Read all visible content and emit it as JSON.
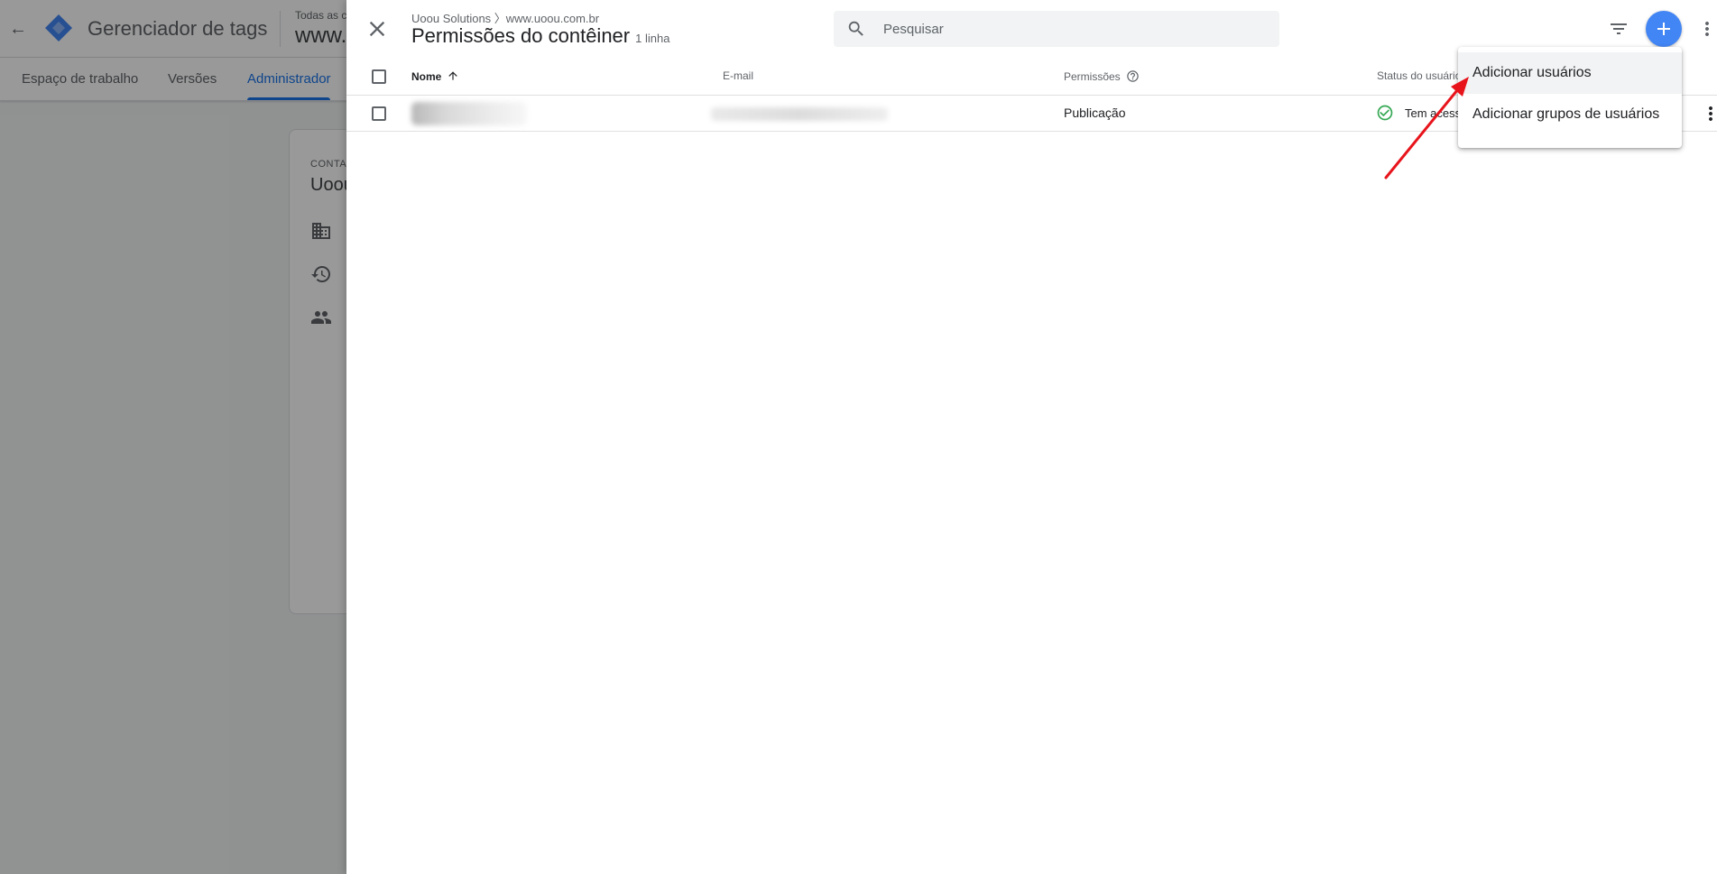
{
  "app": {
    "title": "Gerenciador de tags",
    "account_label": "Todas as c",
    "container_name": "www.",
    "tabs": [
      {
        "label": "Espaço de trabalho"
      },
      {
        "label": "Versões"
      },
      {
        "label": "Administrador",
        "active": true
      }
    ],
    "card": {
      "label": "CONTA",
      "title": "Uoou"
    }
  },
  "panel": {
    "breadcrumb": "Uoou Solutions 〉www.uoou.com.br",
    "title": "Permissões do contêiner",
    "row_count": "1 linha",
    "search": {
      "placeholder": "Pesquisar",
      "value": ""
    },
    "columns": {
      "name": "Nome",
      "email": "E-mail",
      "permissions": "Permissões",
      "status": "Status do usuário"
    },
    "rows": [
      {
        "name": "",
        "email": "",
        "permission": "Publicação",
        "status": "Tem acesso"
      }
    ],
    "menu": {
      "items": [
        {
          "label": "Adicionar usuários"
        },
        {
          "label": "Adicionar grupos de usuários"
        }
      ]
    }
  },
  "colors": {
    "accent": "#1a73e8",
    "fab": "#4285f4",
    "status_ok": "#34a853",
    "annotation": "#e8141c"
  }
}
